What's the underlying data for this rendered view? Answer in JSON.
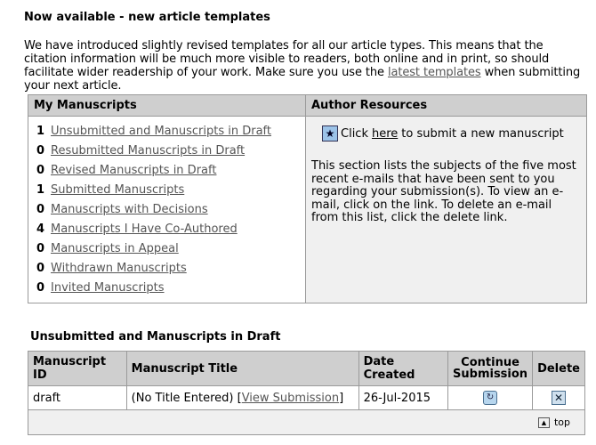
{
  "notice": {
    "title": "Now available - new article templates",
    "text_before": "We have introduced slightly revised templates for all our article types. This means that the citation information will be much more visible to readers, both online and in print, so should facilitate wider readership of your work. Make sure you use the ",
    "link_label": "latest templates",
    "text_after": " when submitting your next article."
  },
  "my_manuscripts": {
    "heading": "My Manuscripts",
    "items": [
      {
        "count": "1",
        "label": "Unsubmitted and Manuscripts in Draft"
      },
      {
        "count": "0",
        "label": "Resubmitted Manuscripts in Draft"
      },
      {
        "count": "0",
        "label": "Revised Manuscripts in Draft"
      },
      {
        "count": "1",
        "label": "Submitted Manuscripts"
      },
      {
        "count": "0",
        "label": "Manuscripts with Decisions"
      },
      {
        "count": "4",
        "label": "Manuscripts I Have Co-Authored"
      },
      {
        "count": "0",
        "label": "Manuscripts in Appeal"
      },
      {
        "count": "0",
        "label": "Withdrawn Manuscripts"
      },
      {
        "count": "0",
        "label": "Invited Manuscripts"
      }
    ]
  },
  "author_resources": {
    "heading": "Author Resources",
    "click_prefix": "Click",
    "here_link": "here",
    "click_suffix": "to submit a new manuscript",
    "description": "This section lists the subjects of the five most recent e-mails that have been sent to you regarding your submission(s). To view an e-mail, click on the link. To delete an e-mail from this list, click the delete link."
  },
  "draft_section": {
    "title": "Unsubmitted and Manuscripts in Draft",
    "columns": {
      "id": "Manuscript ID",
      "title": "Manuscript Title",
      "date": "Date Created",
      "continue_line1": "Continue",
      "continue_line2": "Submission",
      "delete": "Delete"
    },
    "rows": [
      {
        "id": "draft",
        "title": "(No Title Entered)",
        "view_link": "View Submission",
        "date": "26-Jul-2015"
      }
    ],
    "top_link": "top"
  },
  "icons": {
    "star": "star-icon",
    "continue": "continue-icon",
    "delete": "delete-icon",
    "up": "arrow-up-icon"
  }
}
